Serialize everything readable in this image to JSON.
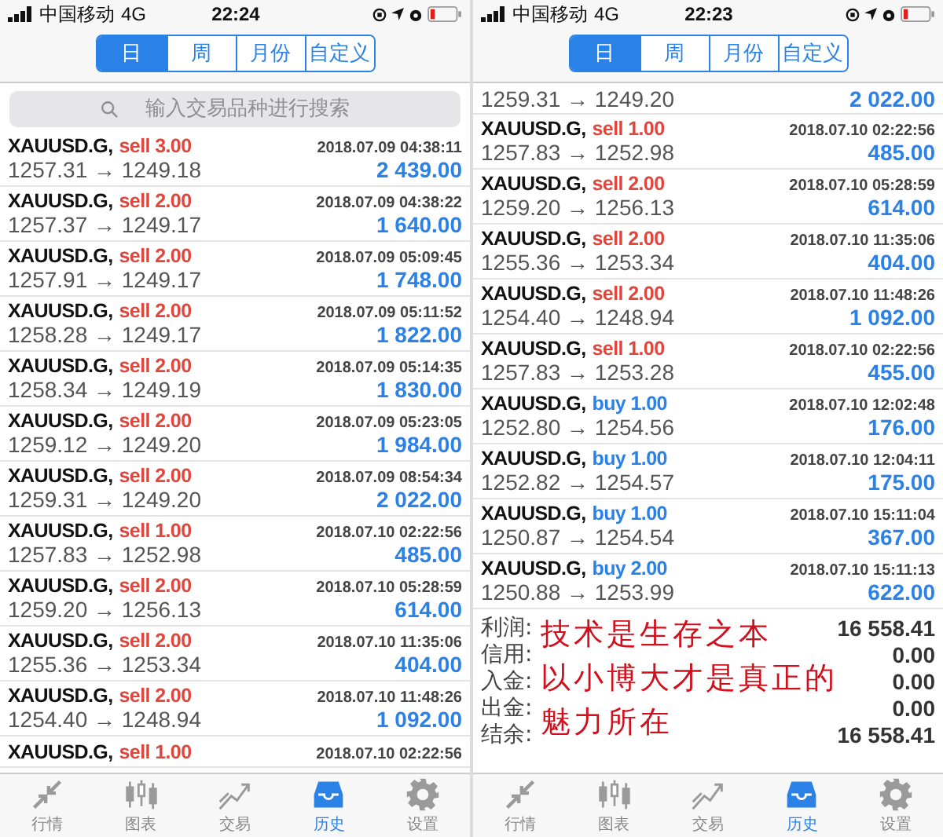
{
  "screens": [
    {
      "status_bar": {
        "carrier": "中国移动",
        "network": "4G",
        "time": "22:24"
      },
      "periods": [
        {
          "label": "日",
          "selected": true
        },
        {
          "label": "周",
          "selected": false
        },
        {
          "label": "月份",
          "selected": false
        },
        {
          "label": "自定义",
          "selected": false
        }
      ],
      "search": {
        "placeholder": "输入交易品种进行搜索"
      },
      "trades": [
        {
          "kind": "sell",
          "symbol": "XAUUSD.G,",
          "side": "sell 3.00",
          "time": "2018.07.09 04:38:11",
          "prices": "1257.31 → 1249.18",
          "profit": "2 439.00"
        },
        {
          "kind": "sell",
          "symbol": "XAUUSD.G,",
          "side": "sell 2.00",
          "time": "2018.07.09 04:38:22",
          "prices": "1257.37 → 1249.17",
          "profit": "1 640.00"
        },
        {
          "kind": "sell",
          "symbol": "XAUUSD.G,",
          "side": "sell 2.00",
          "time": "2018.07.09 05:09:45",
          "prices": "1257.91 → 1249.17",
          "profit": "1 748.00"
        },
        {
          "kind": "sell",
          "symbol": "XAUUSD.G,",
          "side": "sell 2.00",
          "time": "2018.07.09 05:11:52",
          "prices": "1258.28 → 1249.17",
          "profit": "1 822.00"
        },
        {
          "kind": "sell",
          "symbol": "XAUUSD.G,",
          "side": "sell 2.00",
          "time": "2018.07.09 05:14:35",
          "prices": "1258.34 → 1249.19",
          "profit": "1 830.00"
        },
        {
          "kind": "sell",
          "symbol": "XAUUSD.G,",
          "side": "sell 2.00",
          "time": "2018.07.09 05:23:05",
          "prices": "1259.12 → 1249.20",
          "profit": "1 984.00"
        },
        {
          "kind": "sell",
          "symbol": "XAUUSD.G,",
          "side": "sell 2.00",
          "time": "2018.07.09 08:54:34",
          "prices": "1259.31 → 1249.20",
          "profit": "2 022.00"
        },
        {
          "kind": "sell",
          "symbol": "XAUUSD.G,",
          "side": "sell 1.00",
          "time": "2018.07.10 02:22:56",
          "prices": "1257.83 → 1252.98",
          "profit": "485.00"
        },
        {
          "kind": "sell",
          "symbol": "XAUUSD.G,",
          "side": "sell 2.00",
          "time": "2018.07.10 05:28:59",
          "prices": "1259.20 → 1256.13",
          "profit": "614.00"
        },
        {
          "kind": "sell",
          "symbol": "XAUUSD.G,",
          "side": "sell 2.00",
          "time": "2018.07.10 11:35:06",
          "prices": "1255.36 → 1253.34",
          "profit": "404.00"
        },
        {
          "kind": "sell",
          "symbol": "XAUUSD.G,",
          "side": "sell 2.00",
          "time": "2018.07.10 11:48:26",
          "prices": "1254.40 → 1248.94",
          "profit": "1 092.00"
        },
        {
          "kind": "sell",
          "symbol": "XAUUSD.G,",
          "side": "sell 1.00",
          "time": "2018.07.10 02:22:56"
        }
      ],
      "tabs": [
        {
          "label": "行情",
          "selected": false
        },
        {
          "label": "图表",
          "selected": false
        },
        {
          "label": "交易",
          "selected": false
        },
        {
          "label": "历史",
          "selected": true
        },
        {
          "label": "设置",
          "selected": false
        }
      ]
    },
    {
      "status_bar": {
        "carrier": "中国移动",
        "network": "4G",
        "time": "22:23"
      },
      "periods": [
        {
          "label": "日",
          "selected": true
        },
        {
          "label": "周",
          "selected": false
        },
        {
          "label": "月份",
          "selected": false
        },
        {
          "label": "自定义",
          "selected": false
        }
      ],
      "trades": [
        {
          "prices": "1259.31 → 1249.20",
          "profit": "2 022.00"
        },
        {
          "kind": "sell",
          "symbol": "XAUUSD.G,",
          "side": "sell 1.00",
          "time": "2018.07.10 02:22:56",
          "prices": "1257.83 → 1252.98",
          "profit": "485.00"
        },
        {
          "kind": "sell",
          "symbol": "XAUUSD.G,",
          "side": "sell 2.00",
          "time": "2018.07.10 05:28:59",
          "prices": "1259.20 → 1256.13",
          "profit": "614.00"
        },
        {
          "kind": "sell",
          "symbol": "XAUUSD.G,",
          "side": "sell 2.00",
          "time": "2018.07.10 11:35:06",
          "prices": "1255.36 → 1253.34",
          "profit": "404.00"
        },
        {
          "kind": "sell",
          "symbol": "XAUUSD.G,",
          "side": "sell 2.00",
          "time": "2018.07.10 11:48:26",
          "prices": "1254.40 → 1248.94",
          "profit": "1 092.00"
        },
        {
          "kind": "sell",
          "symbol": "XAUUSD.G,",
          "side": "sell 1.00",
          "time": "2018.07.10 02:22:56",
          "prices": "1257.83 → 1253.28",
          "profit": "455.00"
        },
        {
          "kind": "buy",
          "symbol": "XAUUSD.G,",
          "side": "buy 1.00",
          "time": "2018.07.10 12:02:48",
          "prices": "1252.80 → 1254.56",
          "profit": "176.00"
        },
        {
          "kind": "buy",
          "symbol": "XAUUSD.G,",
          "side": "buy 1.00",
          "time": "2018.07.10 12:04:11",
          "prices": "1252.82 → 1254.57",
          "profit": "175.00"
        },
        {
          "kind": "buy",
          "symbol": "XAUUSD.G,",
          "side": "buy 1.00",
          "time": "2018.07.10 15:11:04",
          "prices": "1250.87 → 1254.54",
          "profit": "367.00"
        },
        {
          "kind": "buy",
          "symbol": "XAUUSD.G,",
          "side": "buy 2.00",
          "time": "2018.07.10 15:11:13",
          "prices": "1250.88 → 1253.99",
          "profit": "622.00"
        }
      ],
      "summary": [
        {
          "label": "利润:",
          "value": "16 558.41"
        },
        {
          "label": "信用:",
          "value": "0.00"
        },
        {
          "label": "入金:",
          "value": "0.00"
        },
        {
          "label": "出金:",
          "value": "0.00"
        },
        {
          "label": "结余:",
          "value": "16 558.41"
        }
      ],
      "annotation": {
        "lines": [
          "技术是生存之本",
          "以小博大才是真正的",
          "魅力所在"
        ]
      },
      "tabs": [
        {
          "label": "行情",
          "selected": false
        },
        {
          "label": "图表",
          "selected": false
        },
        {
          "label": "交易",
          "selected": false
        },
        {
          "label": "历史",
          "selected": true
        },
        {
          "label": "设置",
          "selected": false
        }
      ]
    }
  ]
}
